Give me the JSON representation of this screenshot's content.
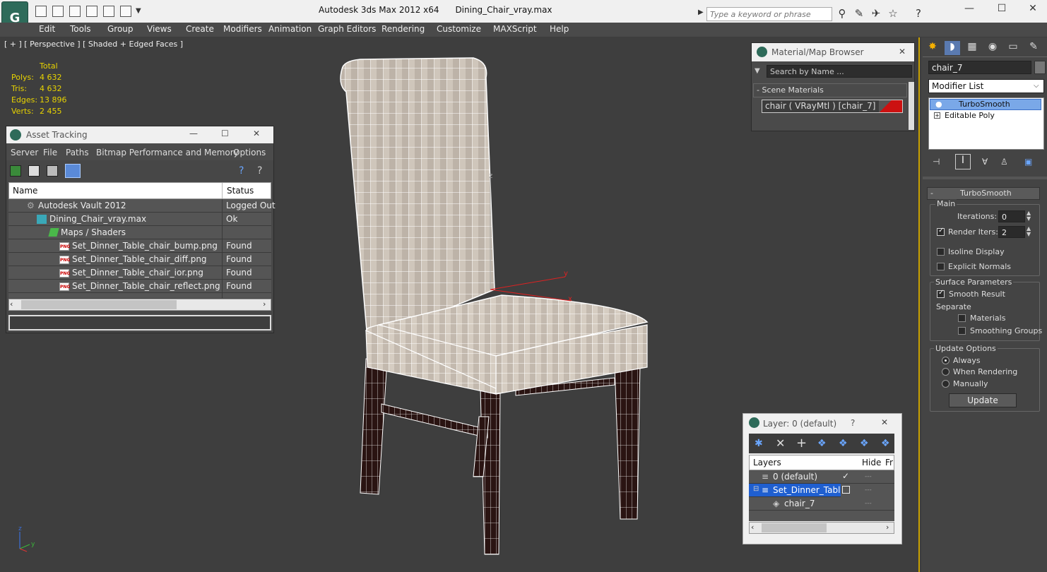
{
  "app": {
    "title": "Autodesk 3ds Max  2012 x64",
    "file": "Dining_Chair_vray.max",
    "search_placeholder": "Type a keyword or phrase"
  },
  "menu": [
    "Edit",
    "Tools",
    "Group",
    "Views",
    "Create",
    "Modifiers",
    "Animation",
    "Graph Editors",
    "Rendering",
    "Customize",
    "MAXScript",
    "Help"
  ],
  "viewport": {
    "label": "[ + ] [ Perspective ] [ Shaded + Edged Faces ]",
    "stats": {
      "header": "Total",
      "polys_label": "Polys:",
      "polys": "4 632",
      "tris_label": "Tris:",
      "tris": "4 632",
      "edges_label": "Edges:",
      "edges": "13 896",
      "verts_label": "Verts:",
      "verts": "2 455"
    },
    "axis": {
      "z": "z",
      "y": "y",
      "x": "x"
    }
  },
  "asset_tracking": {
    "title": "Asset Tracking",
    "menu": [
      "Server",
      "File",
      "Paths",
      "Bitmap Performance and Memory",
      "Options"
    ],
    "col_name": "Name",
    "col_status": "Status",
    "rows": [
      {
        "name": "Autodesk Vault 2012",
        "status": "Logged Out"
      },
      {
        "name": "Dining_Chair_vray.max",
        "status": "Ok"
      },
      {
        "name": "Maps / Shaders",
        "status": ""
      },
      {
        "name": "Set_Dinner_Table_chair_bump.png",
        "status": "Found"
      },
      {
        "name": "Set_Dinner_Table_chair_diff.png",
        "status": "Found"
      },
      {
        "name": "Set_Dinner_Table_chair_ior.png",
        "status": "Found"
      },
      {
        "name": "Set_Dinner_Table_chair_reflect.png",
        "status": "Found"
      }
    ],
    "png_badge": "PNG"
  },
  "material_browser": {
    "title": "Material/Map Browser",
    "search": "Search by Name ...",
    "section": "- Scene Materials",
    "material": "chair  ( VRayMtl ) [chair_7]"
  },
  "layer_window": {
    "title": "Layer: 0 (default)",
    "help": "?",
    "col_layers": "Layers",
    "col_hide": "Hide",
    "col_fr": "Fr",
    "rows": [
      {
        "name": "0 (default)"
      },
      {
        "name": "Set_Dinner_Table"
      },
      {
        "name": "chair_7"
      }
    ]
  },
  "command_panel": {
    "object_name": "chair_7",
    "modifier_list": "Modifier List",
    "stack": [
      "TurboSmooth",
      "Editable Poly"
    ],
    "rollout_title": "TurboSmooth",
    "main": "Main",
    "iterations_label": "Iterations:",
    "iterations": "0",
    "render_iters_label": "Render Iters:",
    "render_iters": "2",
    "isoline": "Isoline Display",
    "explicit": "Explicit Normals",
    "surface": "Surface Parameters",
    "smooth_result": "Smooth Result",
    "separate": "Separate",
    "materials": "Materials",
    "smoothing_groups": "Smoothing Groups",
    "update_options": "Update Options",
    "always": "Always",
    "when_rendering": "When Rendering",
    "manually": "Manually",
    "update_button": "Update"
  }
}
